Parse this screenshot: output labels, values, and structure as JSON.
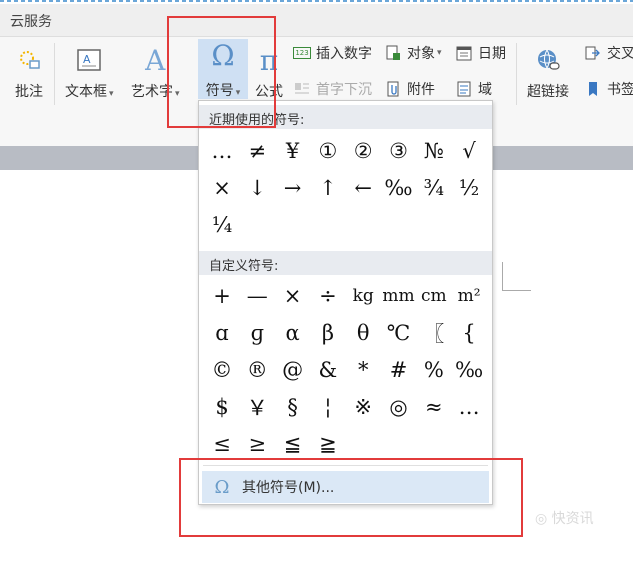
{
  "titlebar": {
    "title": "云服务"
  },
  "ribbon": {
    "comment": "批注",
    "textbox": "文本框",
    "wordart": "艺术字",
    "symbol": "符号",
    "formula": "公式",
    "insert_number": "插入数字",
    "drop_cap": "首字下沉",
    "object": "对象",
    "attachment": "附件",
    "date": "日期",
    "field": "域",
    "hyperlink": "超链接",
    "crossref": "交叉",
    "bookmark": "书签",
    "formula_icon": "π",
    "symbol_icon": "Ω",
    "wordart_icon": "A",
    "number_icon": "123"
  },
  "dropdown": {
    "recent_header": "近期使用的符号:",
    "recent": [
      "…",
      "≠",
      "¥",
      "①",
      "②",
      "③",
      "№",
      "√",
      "×",
      "↓",
      "→",
      "↑",
      "←",
      "‰",
      "¾",
      "½",
      "¼"
    ],
    "custom_header": "自定义符号:",
    "custom": [
      "+",
      "—",
      "×",
      "÷",
      "kg",
      "mm",
      "cm",
      "m²",
      "ɑ",
      "ɡ",
      "α",
      "β",
      "θ",
      "℃",
      "〖",
      "{",
      "©",
      "®",
      "@",
      "&",
      "*",
      "#",
      "%",
      "‰",
      "$",
      "￥",
      "§",
      "¦",
      "※",
      "◎",
      "≈",
      "…",
      "≤",
      "≥",
      "≦",
      "≧"
    ],
    "more_icon": "Ω",
    "more_label": "其他符号(M)..."
  },
  "watermark": "◎ 快资讯"
}
